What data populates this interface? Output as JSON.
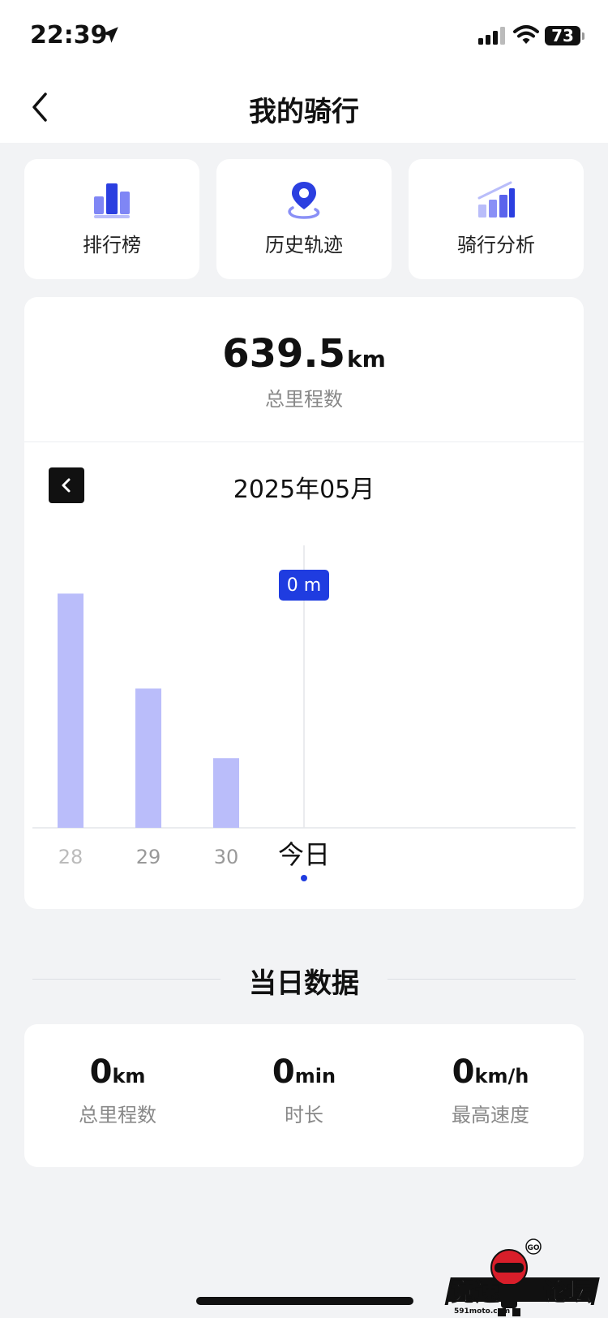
{
  "status_bar": {
    "time": "22:39",
    "battery": "73"
  },
  "nav": {
    "title": "我的骑行"
  },
  "shortcuts": [
    {
      "label": "排行榜",
      "icon": "podium-icon"
    },
    {
      "label": "历史轨迹",
      "icon": "route-pin-icon"
    },
    {
      "label": "骑行分析",
      "icon": "rising-bars-icon"
    }
  ],
  "summary": {
    "total_value": "639.5",
    "total_unit": "km",
    "total_label": "总里程数"
  },
  "calendar": {
    "month": "2025年05月"
  },
  "chart_data": {
    "type": "bar",
    "categories": [
      "28",
      "29",
      "30",
      "今日"
    ],
    "values": [
      0.74,
      0.44,
      0.22,
      0
    ],
    "value_note": "relative daily distance (no y-axis labels shown)",
    "selected_index": 3,
    "selected_label": "0 m",
    "colors": {
      "bar": "#babdfa",
      "badge": "#1f3ce0",
      "dot": "#1f3ce0"
    }
  },
  "daily": {
    "title": "当日数据",
    "metrics": [
      {
        "value": "0",
        "unit": "km",
        "label": "总里程数"
      },
      {
        "value": "0",
        "unit": "min",
        "label": "时长"
      },
      {
        "value": "0",
        "unit": "km/h",
        "label": "最高速度"
      }
    ]
  },
  "watermark": {
    "text": "竞速论坛",
    "site": "591moto.com",
    "badge": "GO"
  }
}
